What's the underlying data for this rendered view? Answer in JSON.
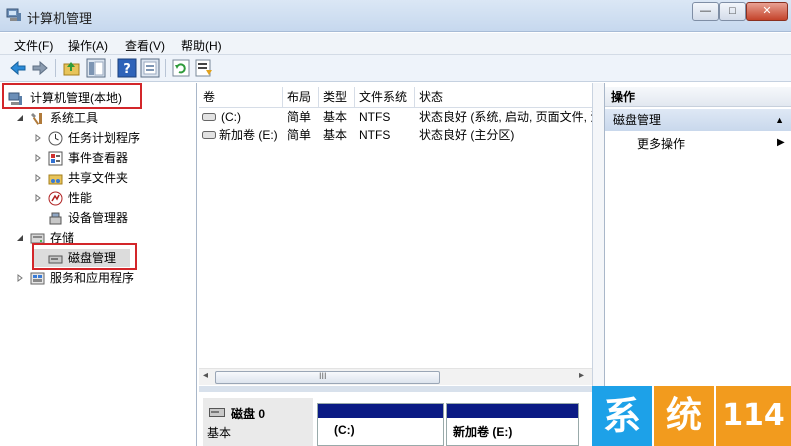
{
  "window": {
    "title": "计算机管理",
    "min_glyph": "—",
    "max_glyph": "□",
    "close_glyph": "✕"
  },
  "menu": [
    "文件(F)",
    "操作(A)",
    "查看(V)",
    "帮助(H)"
  ],
  "toolbar": {
    "icons": [
      "back-arrow-icon",
      "forward-arrow-icon",
      "up-folder-icon",
      "show-hide-tree-icon",
      "help-icon",
      "properties-icon",
      "refresh-icon",
      "export-list-icon"
    ]
  },
  "tree": {
    "root": "计算机管理(本地)",
    "system_tools": "系统工具",
    "task_scheduler": "任务计划程序",
    "event_viewer": "事件查看器",
    "shared_folders": "共享文件夹",
    "performance": "性能",
    "device_manager": "设备管理器",
    "storage": "存储",
    "disk_management": "磁盘管理",
    "services_apps": "服务和应用程序"
  },
  "table": {
    "columns": [
      "卷",
      "布局",
      "类型",
      "文件系统",
      "状态"
    ],
    "rows": [
      [
        "(C:)",
        "简单",
        "基本",
        "NTFS",
        "状态良好 (系统, 启动, 页面文件, 活"
      ],
      [
        "新加卷 (E:)",
        "简单",
        "基本",
        "NTFS",
        "状态良好 (主分区)"
      ]
    ],
    "scroll_glyph": "III"
  },
  "disk": {
    "name": "磁盘 0",
    "type": "基本",
    "partitions": [
      "(C:)",
      "新加卷  (E:)"
    ]
  },
  "actions": {
    "header": "操作",
    "section": "磁盘管理",
    "more": "更多操作"
  },
  "watermark": {
    "chars": [
      "系",
      "统",
      "114"
    ],
    "colors": [
      "#1da1e8",
      "#f29b1e",
      "#f29b1e"
    ]
  },
  "colors": {
    "partition_bar": "#0a1a84",
    "highlight_red": "#d3262a",
    "title_bar": "#dbe7f5"
  }
}
